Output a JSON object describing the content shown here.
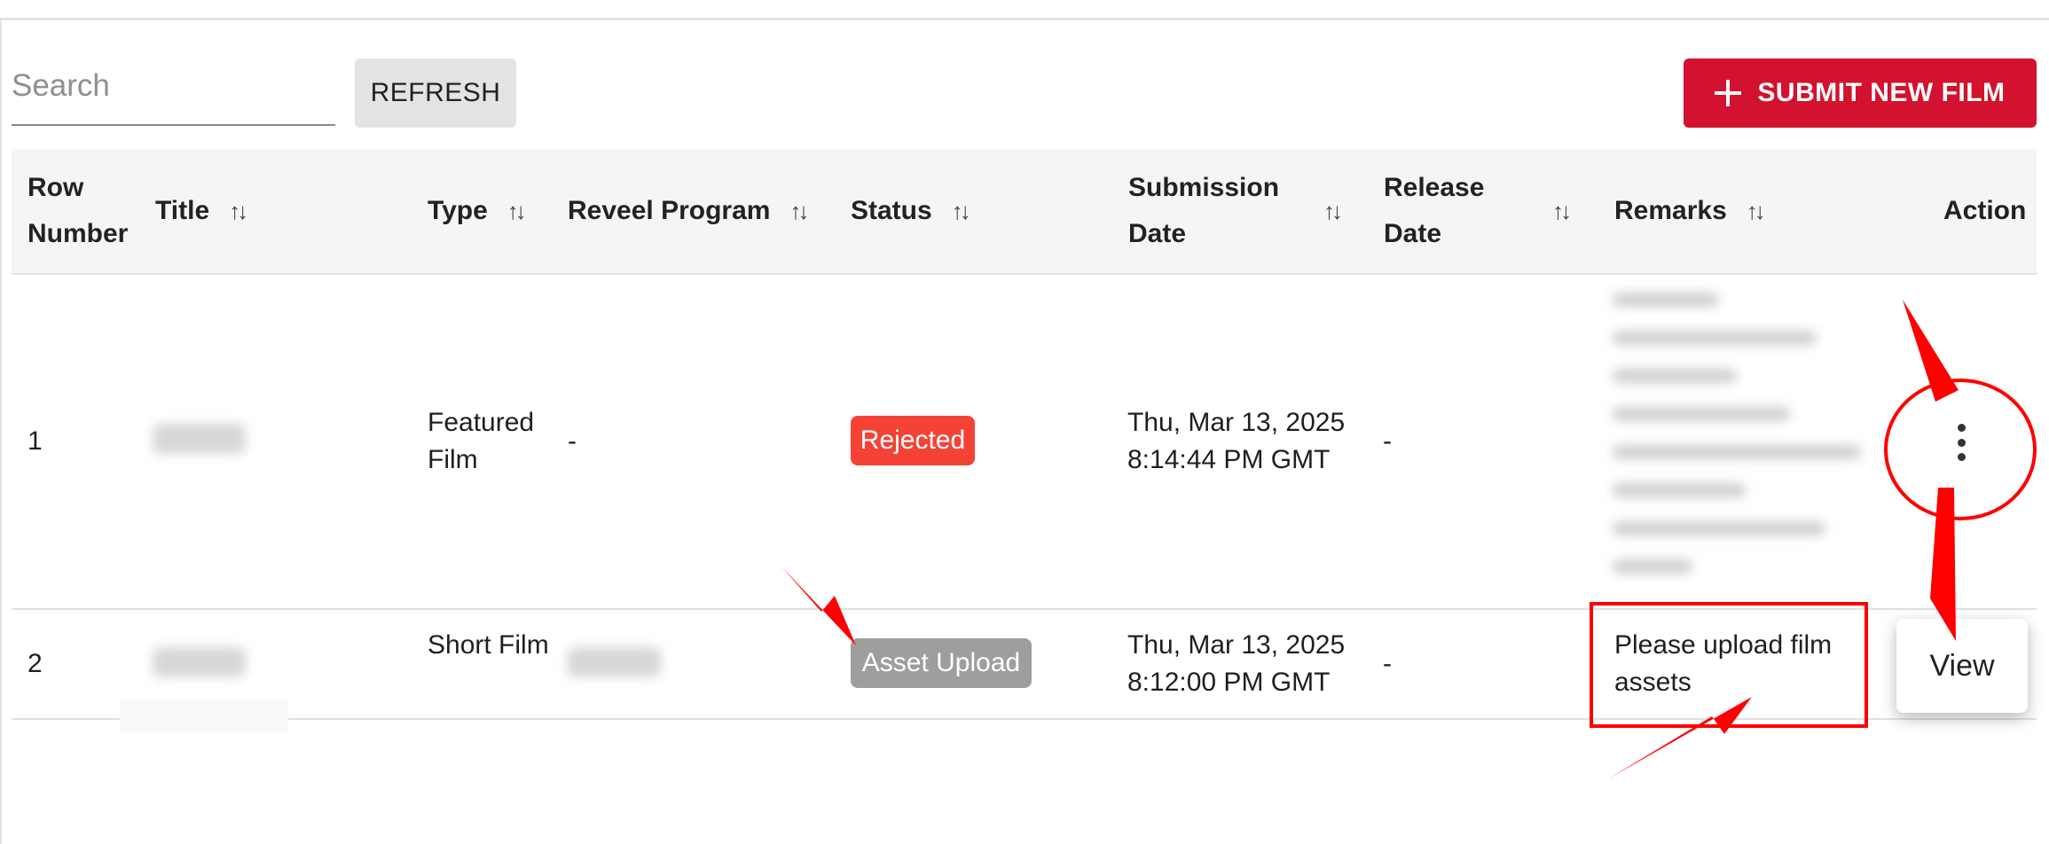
{
  "toolbar": {
    "search_placeholder": "Search",
    "refresh_label": "REFRESH",
    "submit_label": "SUBMIT NEW FILM"
  },
  "table": {
    "columns": [
      "Row Number",
      "Title",
      "Type",
      "Reveel Program",
      "Status",
      "Submission Date",
      "Release Date",
      "Remarks",
      "Action"
    ],
    "rows": [
      {
        "row_number": "1",
        "type": "Featured Film",
        "program": "-",
        "status": "Rejected",
        "submission_date": "Thu, Mar 13, 2025",
        "submission_time": "8:14:44 PM GMT",
        "release_date": "-"
      },
      {
        "row_number": "2",
        "type": "Short Film",
        "status": "Asset Upload",
        "submission_date": "Thu, Mar 13, 2025",
        "submission_time": "8:12:00 PM GMT",
        "release_date": "-",
        "remarks": "Please upload film assets"
      }
    ]
  },
  "menu": {
    "view_label": "View"
  },
  "icons": {
    "plus": "plus-icon",
    "sort": "sort-icon",
    "more": "more-vertical-icon"
  },
  "colors": {
    "primary": "#d2122e",
    "rejected": "#f44336",
    "asset_upload": "#9e9e9e",
    "annotation": "#ff0000"
  }
}
